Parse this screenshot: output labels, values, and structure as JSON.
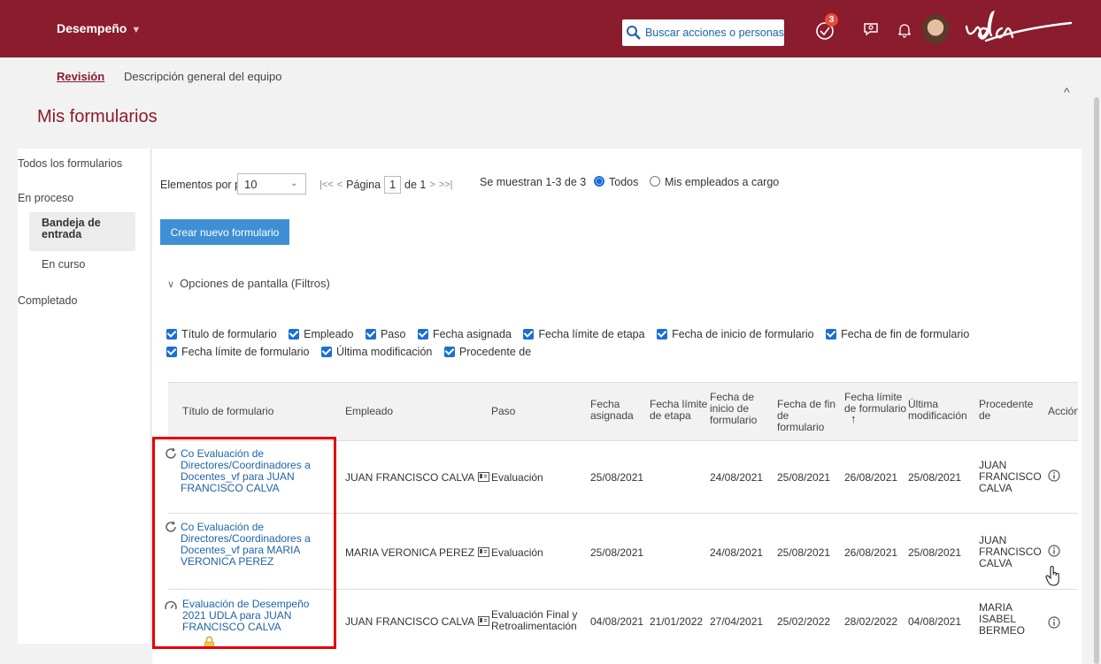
{
  "topbar": {
    "module": "Desempeño",
    "search_placeholder": "Buscar acciones o personas",
    "todo_badge": "3"
  },
  "subnav": {
    "tab_active": "Revisión",
    "tab_other": "Descripción general del equipo"
  },
  "page": {
    "title": "Mis formularios"
  },
  "leftnav": {
    "all": "Todos los formularios",
    "in_process": "En proceso",
    "inbox": "Bandeja de entrada",
    "in_course": "En curso",
    "completed": "Completado"
  },
  "toolbar": {
    "per_page_label": "Elementos por página",
    "per_page_value": "10",
    "page_label": "Página",
    "page_value": "1",
    "page_of": "de 1",
    "showing": "Se muestran 1-3 de 3",
    "radio_all": "Todos",
    "radio_reports": "Mis empleados a cargo",
    "create_button": "Crear nuevo formulario",
    "display_options": "Opciones de pantalla (Filtros)"
  },
  "filters": [
    "Título de formulario",
    "Empleado",
    "Paso",
    "Fecha asignada",
    "Fecha límite de etapa",
    "Fecha de inicio de formulario",
    "Fecha de fin de formulario",
    "Fecha límite de formulario",
    "Última modificación",
    "Procedente de"
  ],
  "table": {
    "headers": {
      "title": "Título de formulario",
      "employee": "Empleado",
      "step": "Paso",
      "assigned": "Fecha asignada",
      "stage_due": "Fecha límite de etapa",
      "start": "Fecha de inicio de formulario",
      "end": "Fecha de fin de formulario",
      "due": "Fecha límite de formulario",
      "modified": "Última modificación",
      "from": "Procedente de",
      "action": "Acción"
    },
    "rows": [
      {
        "title": "Co Evaluación de Directores/Coordinadores a Docentes_vf para JUAN FRANCISCO CALVA",
        "employee": "JUAN FRANCISCO CALVA",
        "step": "Evaluación",
        "assigned": "25/08/2021",
        "stage_due": "",
        "start": "24/08/2021",
        "end": "25/08/2021",
        "due": "26/08/2021",
        "modified": "25/08/2021",
        "from": "JUAN FRANCISCO CALVA"
      },
      {
        "title": "Co Evaluación de Directores/Coordinadores a Docentes_vf para MARIA VERONICA PEREZ",
        "employee": "MARIA VERONICA PEREZ",
        "step": "Evaluación",
        "assigned": "25/08/2021",
        "stage_due": "",
        "start": "24/08/2021",
        "end": "25/08/2021",
        "due": "26/08/2021",
        "modified": "25/08/2021",
        "from": "JUAN FRANCISCO CALVA"
      },
      {
        "title": "Evaluación de Desempeño 2021 UDLA para JUAN FRANCISCO CALVA",
        "employee": "JUAN FRANCISCO CALVA",
        "step": "Evaluación Final y Retroalimentación",
        "assigned": "04/08/2021",
        "stage_due": "21/01/2022",
        "start": "27/04/2021",
        "end": "25/02/2022",
        "due": "28/02/2022",
        "modified": "04/08/2021",
        "from": "MARIA ISABEL BERMEO"
      }
    ]
  }
}
